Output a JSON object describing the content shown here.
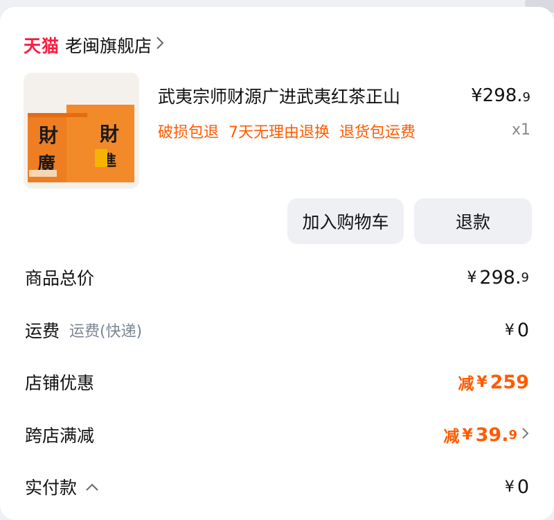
{
  "shop": {
    "brand": "天猫",
    "name": "老闽旗舰店"
  },
  "product": {
    "title": "武夷宗师财源广进武夷红茶正山",
    "price_int": "¥298.",
    "price_dec": "9",
    "quantity": "x1",
    "tags": [
      "破损包退",
      "7天无理由退换",
      "退货包运费"
    ],
    "image_text": "财源广进"
  },
  "actions": {
    "add_to_cart": "加入购物车",
    "refund": "退款"
  },
  "summary": {
    "subtotal_label": "商品总价",
    "subtotal_int": "298.",
    "subtotal_dec": "9",
    "shipping_label": "运费",
    "shipping_sub": "运费(快递)",
    "shipping_value": "0",
    "store_discount_label": "店铺优惠",
    "store_discount_prefix": "减",
    "store_discount_value": "259",
    "cross_discount_label": "跨店满减",
    "cross_discount_prefix": "减",
    "cross_discount_int": "39.",
    "cross_discount_dec": "9",
    "paid_label": "实付款",
    "paid_value": "0",
    "currency": "¥"
  },
  "colors": {
    "brand_red": "#ff1b3f",
    "accent_orange": "#ff5a00"
  }
}
